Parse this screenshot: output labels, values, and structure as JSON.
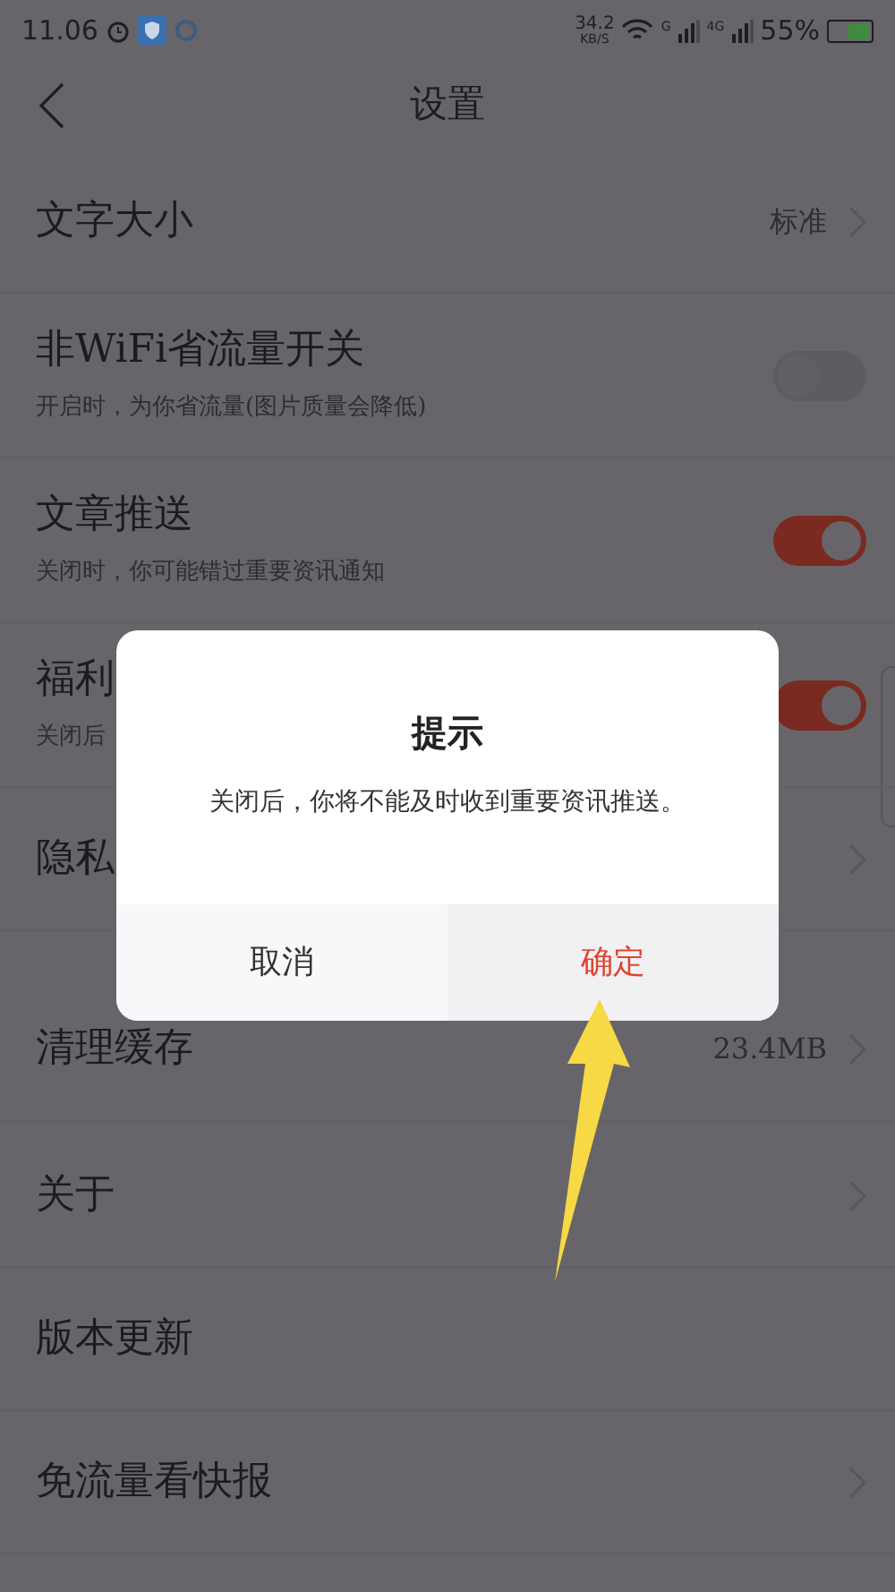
{
  "status_bar": {
    "time": "11.06",
    "speed": "34.2",
    "speed_unit": "KB/S",
    "sim1": "G",
    "sim2": "4G",
    "battery": "55%"
  },
  "header": {
    "title": "设置"
  },
  "sections": [
    {
      "rows": [
        {
          "kind": "value",
          "title": "文字大小",
          "value": "标准"
        },
        {
          "kind": "toggle",
          "title": "非WiFi省流量开关",
          "subtitle": "开启时，为你省流量(图片质量会降低)",
          "on": false
        },
        {
          "kind": "toggle",
          "title": "文章推送",
          "subtitle": "关闭时，你可能错过重要资讯通知",
          "on": true
        },
        {
          "kind": "toggle",
          "title": "福利",
          "subtitle": "关闭后",
          "on": true
        },
        {
          "kind": "link",
          "title": "隐私"
        }
      ]
    },
    {
      "rows": [
        {
          "kind": "value",
          "title": "清理缓存",
          "value": "23.4MB"
        }
      ]
    },
    {
      "rows": [
        {
          "kind": "link",
          "title": "关于"
        },
        {
          "kind": "plain",
          "title": "版本更新"
        },
        {
          "kind": "link",
          "title": "免流量看快报"
        }
      ]
    }
  ],
  "dialog": {
    "title": "提示",
    "message": "关闭后，你将不能及时收到重要资讯推送。",
    "buttons": [
      {
        "label": "取消",
        "selected": false
      },
      {
        "label": "确定",
        "selected": true
      }
    ]
  }
}
